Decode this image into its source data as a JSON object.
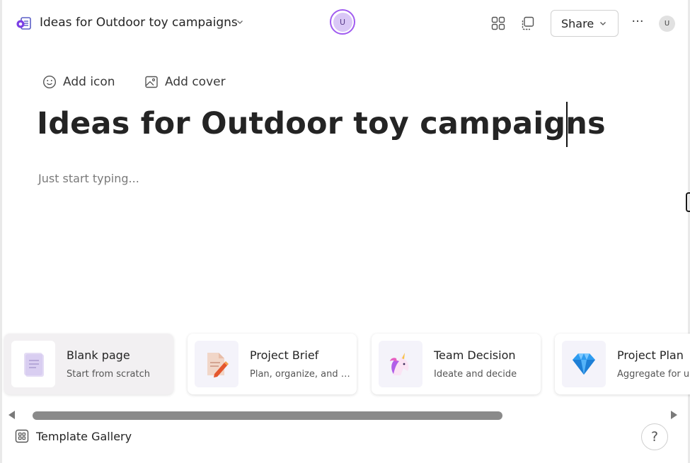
{
  "header": {
    "doc_title": "Ideas for Outdoor toy campaigns",
    "presence_initial": "U",
    "share_label": "Share",
    "more_label": "···",
    "user_initial": "U",
    "accent_color": "#a05bf0"
  },
  "page": {
    "add_icon_label": "Add icon",
    "add_cover_label": "Add cover",
    "heading": "Ideas for Outdoor toy campaigns",
    "placeholder": "Just start typing..."
  },
  "templates": [
    {
      "name": "Blank page",
      "description": "Start from scratch",
      "icon": "blank-page-icon"
    },
    {
      "name": "Project Brief",
      "description": "Plan, organize, and t...",
      "icon": "pencil-document-icon"
    },
    {
      "name": "Team Decision",
      "description": "Ideate and decide",
      "icon": "unicorn-icon"
    },
    {
      "name": "Project Plan",
      "description": "Aggregate for u",
      "icon": "diamond-icon"
    }
  ],
  "footer": {
    "gallery_label": "Template Gallery",
    "help_label": "?"
  }
}
